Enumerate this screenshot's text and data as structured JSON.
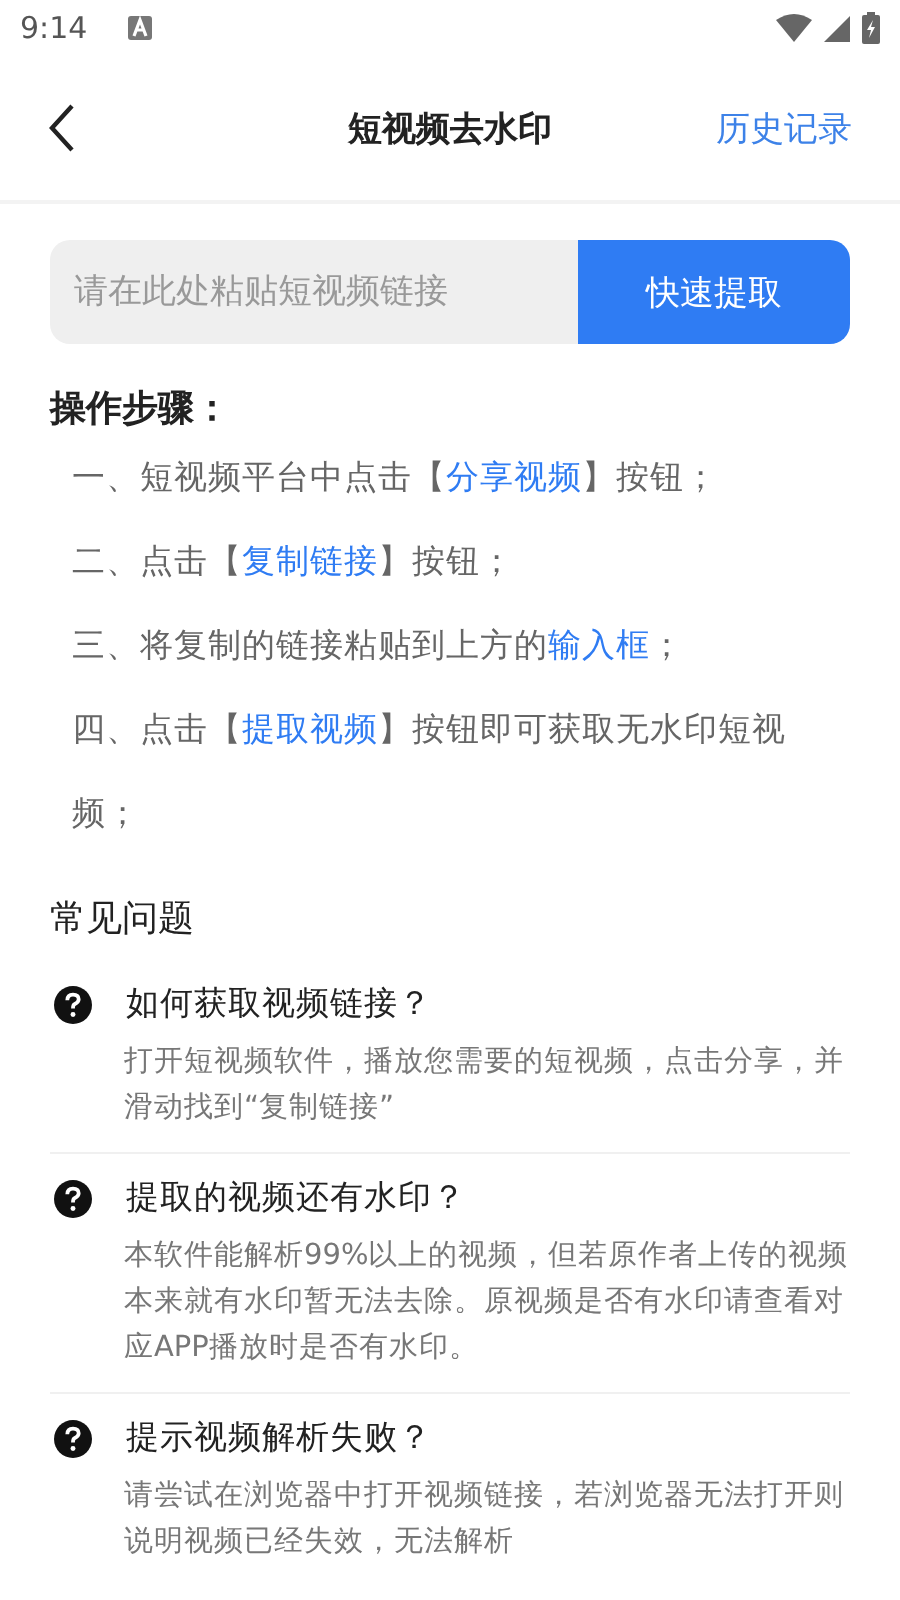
{
  "status_bar": {
    "time": "9:14"
  },
  "header": {
    "title": "短视频去水印",
    "action": "历史记录"
  },
  "search": {
    "placeholder": "请在此处粘贴短视频链接",
    "button": "快速提取"
  },
  "steps": {
    "title": "操作步骤：",
    "items": [
      [
        {
          "text": "一、短视频平台中点击【",
          "kind": "plain"
        },
        {
          "text": "分享视频",
          "kind": "link"
        },
        {
          "text": "】按钮；",
          "kind": "plain"
        }
      ],
      [
        {
          "text": "二、点击【",
          "kind": "plain"
        },
        {
          "text": "复制链接",
          "kind": "link"
        },
        {
          "text": "】按钮；",
          "kind": "plain"
        }
      ],
      [
        {
          "text": "三、将复制的链接粘贴到上方的",
          "kind": "plain"
        },
        {
          "text": "输入框",
          "kind": "link"
        },
        {
          "text": "；",
          "kind": "plain"
        }
      ],
      [
        {
          "text": "四、点击【",
          "kind": "plain"
        },
        {
          "text": "提取视频",
          "kind": "link"
        },
        {
          "text": "】按钮即可获取无水印短视频；",
          "kind": "plain"
        }
      ]
    ]
  },
  "faq": {
    "title": "常见问题",
    "items": [
      {
        "question": "如何获取视频链接？",
        "answer": "打开短视频软件，播放您需要的短视频，点击分享，并滑动找到“复制链接”"
      },
      {
        "question": "提取的视频还有水印？",
        "answer": "本软件能解析99%以上的视频，但若原作者上传的视频本来就有水印暂无法去除。原视频是否有水印请查看对应APP播放时是否有水印。"
      },
      {
        "question": "提示视频解析失败？",
        "answer": "请尝试在浏览器中打开视频链接，若浏览器无法打开则说明视频已经失效，无法解析"
      }
    ]
  }
}
